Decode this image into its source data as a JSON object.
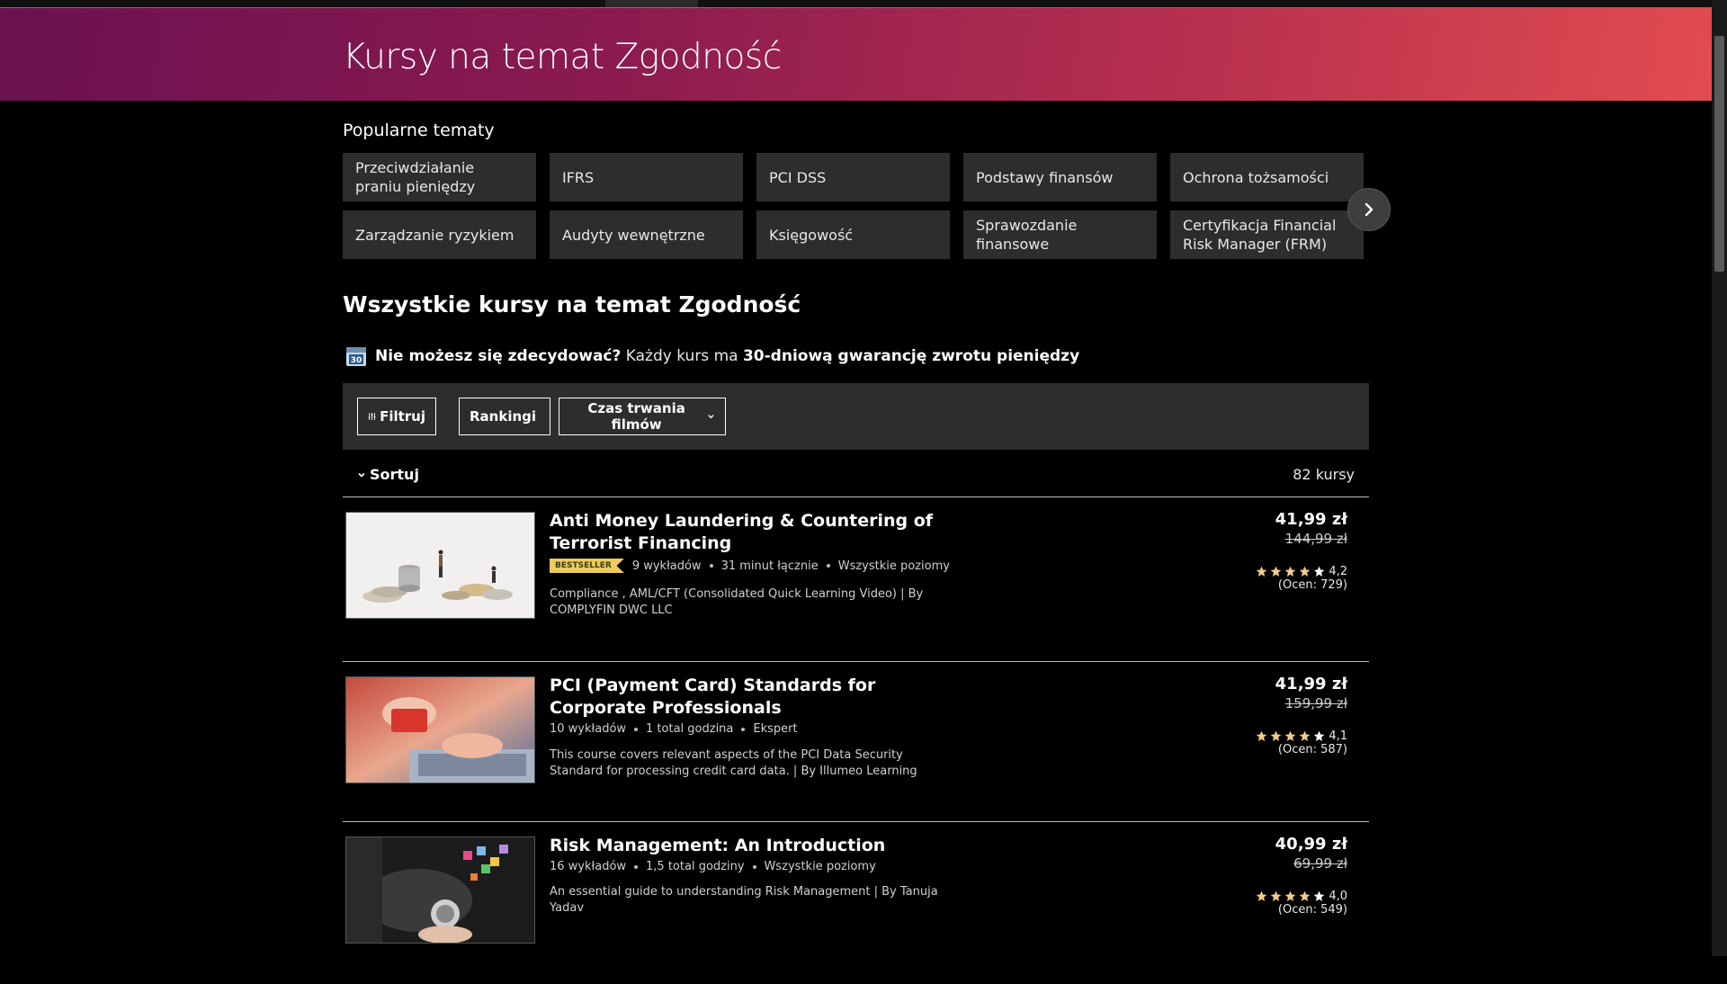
{
  "hero": {
    "title": "Kursy na temat Zgodność"
  },
  "popular": {
    "title": "Popularne tematy",
    "topics": [
      "Przeciwdziałanie praniu pieniędzy",
      "IFRS",
      "PCI DSS",
      "Podstawy finansów",
      "Ochrona tożsamości",
      "Zarządzanie ryzykiem",
      "Audyty wewnętrzne",
      "Księgowość",
      "Sprawozdanie finansowe",
      "Certyfikacja Financial Risk Manager (FRM)"
    ]
  },
  "all_courses": {
    "title": "Wszystkie kursy na temat Zgodność"
  },
  "guarantee": {
    "calendar_day": "30",
    "bold_lead": "Nie możesz się zdecydować?",
    "text": "Każdy kurs ma",
    "bold_tail": "30-dniową gwarancję zwrotu pieniędzy"
  },
  "filters": {
    "filter_label": "Filtruj",
    "ratings_label": "Rankingi",
    "duration_label": "Czas trwania filmów"
  },
  "sort": {
    "label": "Sortuj",
    "count": "82 kursy"
  },
  "courses": [
    {
      "title": "Anti Money Laundering & Countering of Terrorist Financing",
      "badge": "BESTSELLER",
      "lectures": "9 wykładów",
      "duration": "31 minut łącznie",
      "level": "Wszystkie poziomy",
      "description": "Compliance , AML/CFT (Consolidated Quick Learning Video) | By COMPLYFIN DWC LLC",
      "price": "41,99 zł",
      "old_price": "144,99 zł",
      "rating": "4,2",
      "rating_value": 4.2,
      "reviews": "(Ocen: 729)"
    },
    {
      "title": "PCI (Payment Card) Standards for Corporate Professionals",
      "badge": "",
      "lectures": "10 wykładów",
      "duration": "1 total godzina",
      "level": "Ekspert",
      "description": "This course covers relevant aspects of the PCI Data Security Standard for processing credit card data. | By Illumeo Learning",
      "price": "41,99 zł",
      "old_price": "159,99 zł",
      "rating": "4,1",
      "rating_value": 4.1,
      "reviews": "(Ocen: 587)"
    },
    {
      "title": "Risk Management: An Introduction",
      "badge": "",
      "lectures": "16 wykładów",
      "duration": "1,5 total godziny",
      "level": "Wszystkie poziomy",
      "description": "An essential guide to understanding Risk Management | By Tanuja Yadav",
      "price": "40,99 zł",
      "old_price": "69,99 zł",
      "rating": "4,0",
      "rating_value": 4.0,
      "reviews": "(Ocen: 549)"
    }
  ],
  "colors": {
    "hero_start": "#6b1150",
    "hero_end": "#e24c4f",
    "topic_bg": "#2d2d2e",
    "star": "#f3ca8c",
    "badge": "#eccb5f"
  }
}
